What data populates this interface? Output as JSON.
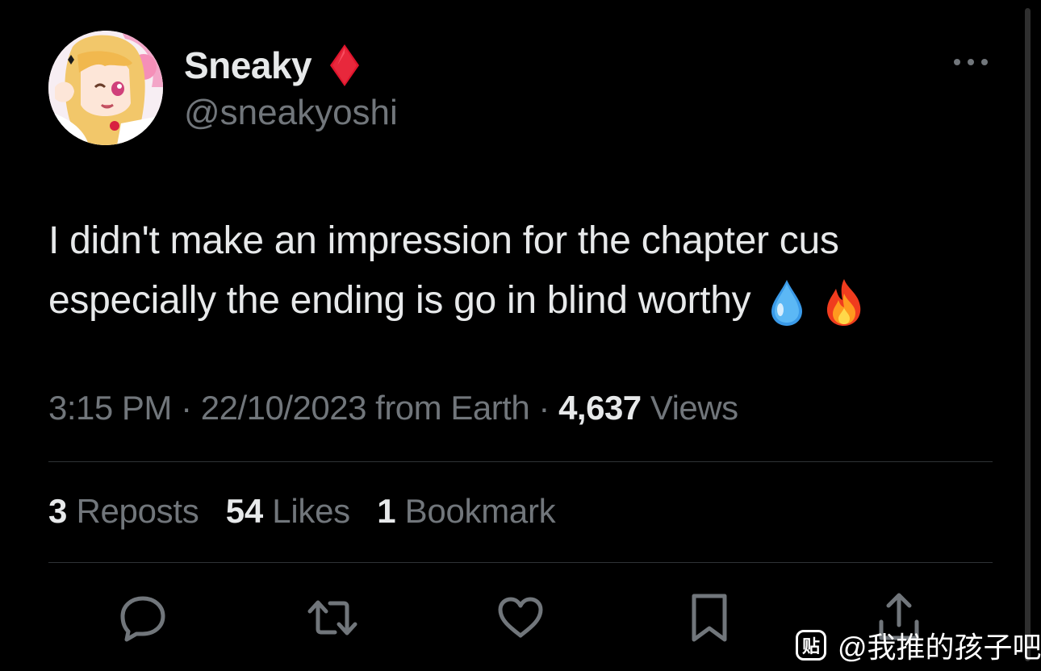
{
  "author": {
    "display_name": "Sneaky",
    "handle": "@sneakyoshi",
    "badge_icon": "red-diamond-icon",
    "badge_color": "#e0142c"
  },
  "tweet": {
    "line1": "I didn't make an impression for the chapter cus",
    "line2": "especially the ending is go in blind worthy",
    "emojis": [
      "droplet-emoji",
      "fire-emoji"
    ]
  },
  "meta": {
    "time": "3:15 PM",
    "separator": "·",
    "date": "22/10/2023",
    "source": "from Earth",
    "views_count": "4,637",
    "views_label": "Views"
  },
  "stats": {
    "reposts_count": "3",
    "reposts_label": "Reposts",
    "likes_count": "54",
    "likes_label": "Likes",
    "bookmarks_count": "1",
    "bookmarks_label": "Bookmark"
  },
  "actions": [
    {
      "name": "reply",
      "icon": "speech-bubble-icon"
    },
    {
      "name": "repost",
      "icon": "repost-arrows-icon"
    },
    {
      "name": "like",
      "icon": "heart-icon"
    },
    {
      "name": "bookmark",
      "icon": "bookmark-icon"
    },
    {
      "name": "share",
      "icon": "share-arrow-icon"
    }
  ],
  "watermark": {
    "logo_text": "贴",
    "text": "@我推的孩子吧"
  },
  "colors": {
    "background": "#000000",
    "primary_text": "#e7e9ea",
    "secondary_text": "#71767b",
    "divider": "#2f3336"
  }
}
